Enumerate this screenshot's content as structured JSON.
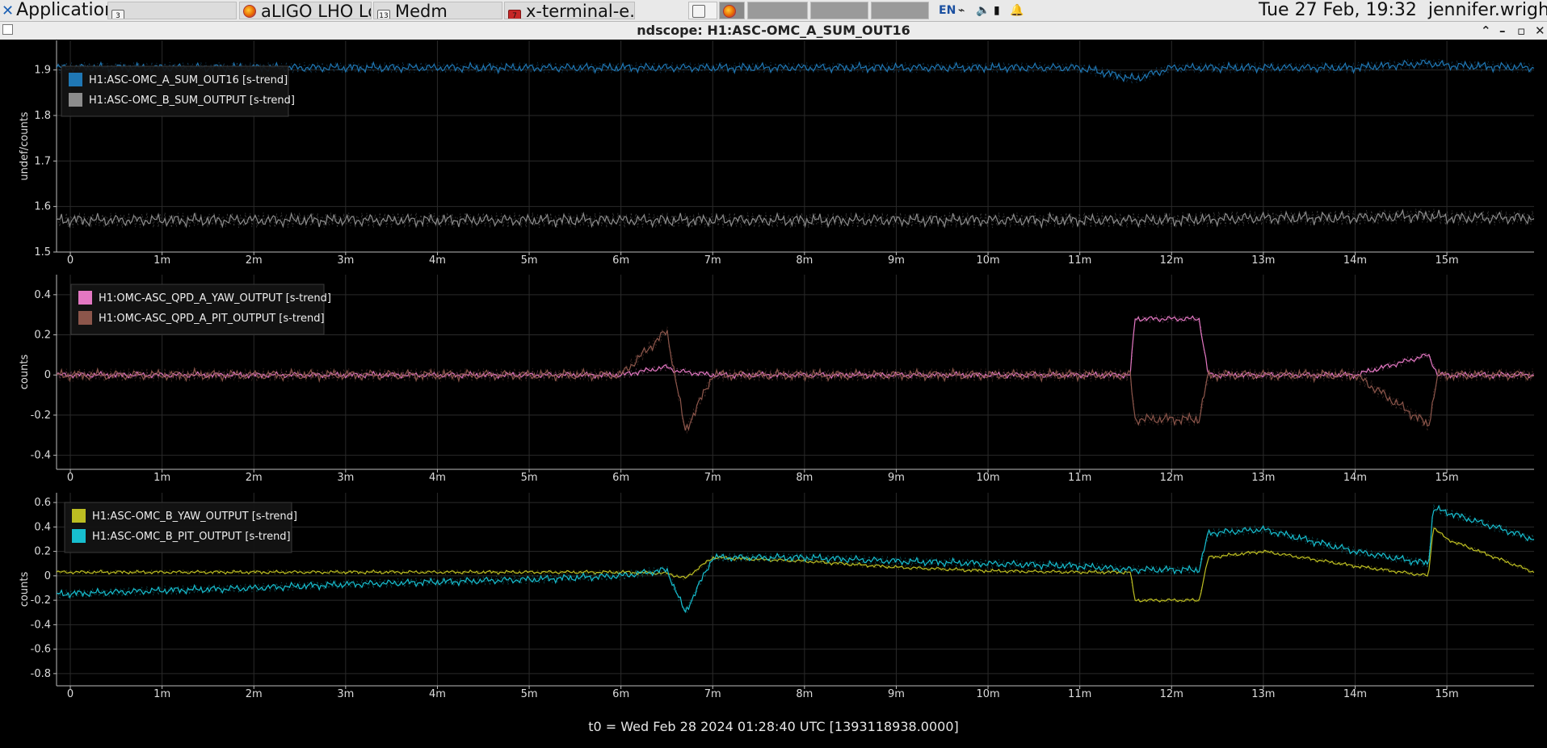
{
  "taskbar": {
    "applications_label": "Applications",
    "tasks": [
      {
        "label": "",
        "icon": "window-icon",
        "badge": "3"
      },
      {
        "label": "aLIGO LHO Lo...",
        "icon": "firefox-icon"
      },
      {
        "label": "Medm",
        "icon": "window-icon",
        "badge": "13"
      },
      {
        "label": "x-terminal-e...",
        "icon": "terminal-icon",
        "badge": "7"
      }
    ],
    "language": "EN",
    "clock": "Tue 27 Feb, 19:32",
    "user": "jennifer.wright"
  },
  "window": {
    "title": "ndscope: H1:ASC-OMC_A_SUM_OUT16",
    "footer": "t0 = Wed Feb 28 2024 01:28:40 UTC [1393118938.0000]"
  },
  "chart_data": [
    {
      "type": "line",
      "ylabel": "undef/counts",
      "xlabel": "",
      "x_ticks": [
        "0",
        "1m",
        "2m",
        "3m",
        "4m",
        "5m",
        "6m",
        "7m",
        "8m",
        "9m",
        "10m",
        "11m",
        "12m",
        "13m",
        "14m",
        "15m"
      ],
      "xlim": [
        -0.15,
        15.95
      ],
      "ylim": [
        1.5,
        1.965
      ],
      "y_ticks": [
        1.5,
        1.6,
        1.7,
        1.8,
        1.9
      ],
      "grid": true,
      "legend": "top-left",
      "series": [
        {
          "name": "H1:ASC-OMC_A_SUM_OUT16 [s-trend]",
          "color": "#1f77b4",
          "x": [
            0,
            1,
            2,
            3,
            4,
            5,
            6,
            7,
            8,
            9,
            10,
            11,
            11.6,
            12,
            13,
            14,
            14.8,
            15,
            15.95
          ],
          "y": [
            1.905,
            1.905,
            1.905,
            1.905,
            1.905,
            1.905,
            1.905,
            1.905,
            1.905,
            1.905,
            1.905,
            1.905,
            1.88,
            1.905,
            1.905,
            1.905,
            1.915,
            1.91,
            1.905
          ]
        },
        {
          "name": "H1:ASC-OMC_B_SUM_OUTPUT [s-trend]",
          "color": "#8c8c8c",
          "x": [
            0,
            1,
            2,
            3,
            4,
            5,
            6,
            7,
            8,
            9,
            10,
            11,
            12,
            13,
            14,
            14.8,
            15,
            15.95
          ],
          "y": [
            1.57,
            1.57,
            1.57,
            1.57,
            1.57,
            1.57,
            1.57,
            1.57,
            1.57,
            1.57,
            1.57,
            1.57,
            1.57,
            1.575,
            1.575,
            1.58,
            1.575,
            1.575
          ]
        }
      ]
    },
    {
      "type": "line",
      "ylabel": "counts",
      "xlabel": "",
      "x_ticks": [
        "0",
        "1m",
        "2m",
        "3m",
        "4m",
        "5m",
        "6m",
        "7m",
        "8m",
        "9m",
        "10m",
        "11m",
        "12m",
        "13m",
        "14m",
        "15m"
      ],
      "xlim": [
        -0.15,
        15.95
      ],
      "ylim": [
        -0.47,
        0.5
      ],
      "y_ticks": [
        -0.4,
        -0.2,
        0,
        0.2,
        0.4
      ],
      "grid": true,
      "legend": "top-left",
      "series": [
        {
          "name": "H1:OMC-ASC_QPD_A_YAW_OUTPUT [s-trend]",
          "color": "#e377c2",
          "x": [
            0,
            3,
            6,
            6.5,
            6.6,
            7,
            10,
            11,
            11.55,
            11.6,
            12.3,
            12.4,
            13,
            14,
            14.8,
            14.9,
            15.95
          ],
          "y": [
            0,
            0,
            0,
            0.04,
            0.02,
            0,
            0,
            0,
            0,
            0.28,
            0.28,
            0,
            0,
            0,
            0.1,
            0,
            0
          ]
        },
        {
          "name": "H1:OMC-ASC_QPD_A_PIT_OUTPUT [s-trend]",
          "color": "#8c564b",
          "x": [
            0,
            3,
            6,
            6.5,
            6.7,
            7,
            10,
            11,
            11.55,
            11.6,
            12.3,
            12.4,
            13,
            14,
            14.8,
            14.9,
            15.95
          ],
          "y": [
            0,
            0,
            0,
            0.22,
            -0.28,
            0,
            0,
            0,
            0,
            -0.22,
            -0.22,
            0,
            0,
            0,
            -0.25,
            0,
            0
          ]
        }
      ]
    },
    {
      "type": "line",
      "ylabel": "counts",
      "xlabel": "",
      "x_ticks": [
        "0",
        "1m",
        "2m",
        "3m",
        "4m",
        "5m",
        "6m",
        "7m",
        "8m",
        "9m",
        "10m",
        "11m",
        "12m",
        "13m",
        "14m",
        "15m"
      ],
      "xlim": [
        -0.15,
        15.95
      ],
      "ylim": [
        -0.9,
        0.68
      ],
      "y_ticks": [
        -0.8,
        -0.6,
        -0.4,
        -0.2,
        0,
        0.2,
        0.4,
        0.6
      ],
      "grid": true,
      "legend": "top-left",
      "series": [
        {
          "name": "H1:ASC-OMC_B_YAW_OUTPUT [s-trend]",
          "color": "#bcbd22",
          "x": [
            -0.15,
            1,
            2,
            3,
            4,
            5,
            6,
            6.5,
            6.7,
            7,
            8,
            9,
            10,
            11,
            11.55,
            11.6,
            12.3,
            12.4,
            13,
            14,
            14.8,
            14.85,
            15,
            15.95
          ],
          "y": [
            0.03,
            0.03,
            0.03,
            0.03,
            0.03,
            0.03,
            0.03,
            0.02,
            -0.02,
            0.15,
            0.12,
            0.07,
            0.04,
            0.03,
            0.03,
            -0.2,
            -0.2,
            0.15,
            0.2,
            0.08,
            0.0,
            0.4,
            0.3,
            0.03
          ]
        },
        {
          "name": "H1:ASC-OMC_B_PIT_OUTPUT [s-trend]",
          "color": "#17becf",
          "x": [
            -0.15,
            1,
            2,
            3,
            4,
            5,
            6,
            6.5,
            6.7,
            7,
            8,
            9,
            10,
            11,
            11.55,
            11.6,
            12.3,
            12.4,
            13,
            14,
            14.8,
            14.85,
            15,
            15.95
          ],
          "y": [
            -0.15,
            -0.12,
            -0.1,
            -0.07,
            -0.05,
            -0.03,
            0,
            0.05,
            -0.3,
            0.15,
            0.15,
            0.12,
            0.1,
            0.08,
            0.05,
            0.05,
            0.05,
            0.35,
            0.38,
            0.2,
            0.1,
            0.55,
            0.52,
            0.3
          ]
        }
      ]
    }
  ]
}
